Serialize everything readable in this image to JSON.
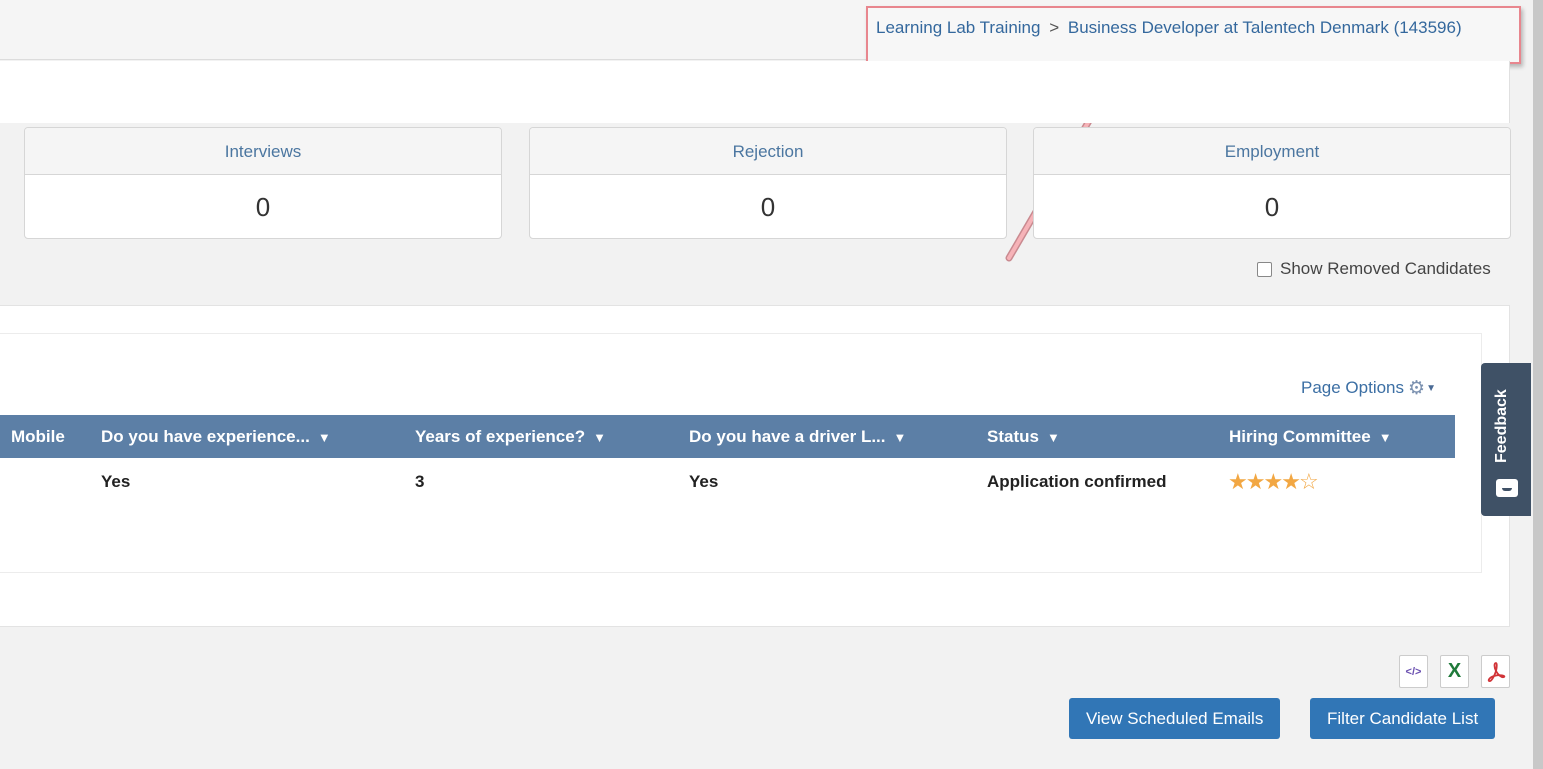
{
  "breadcrumb": {
    "parent": "Learning Lab Training",
    "separator": ">",
    "current": "Business Developer at Talentech Denmark (143596)"
  },
  "stats": [
    {
      "label": "Interviews",
      "value": "0"
    },
    {
      "label": "Rejection",
      "value": "0"
    },
    {
      "label": "Employment",
      "value": "0"
    }
  ],
  "show_removed_label": "Show Removed Candidates",
  "page_options_label": "Page Options",
  "grid": {
    "columns": [
      "Mobile",
      "Do you have experience...",
      "Years of experience?",
      "Do you have a driver L...",
      "Status",
      "Hiring Committee"
    ],
    "row": {
      "experience": "Yes",
      "years": "3",
      "driver": "Yes",
      "status": "Application confirmed",
      "rating": 4,
      "rating_max": 5
    }
  },
  "feedback_label": "Feedback",
  "buttons": {
    "view_scheduled_emails": "View Scheduled Emails",
    "filter_candidate_list": "Filter Candidate List"
  },
  "export_icons": {
    "embed": "</>",
    "excel": "X"
  },
  "colors": {
    "header_bg": "#5c7fa6",
    "primary_button": "#3176b6",
    "star": "#f2a743",
    "highlight_border": "#e8868e"
  }
}
